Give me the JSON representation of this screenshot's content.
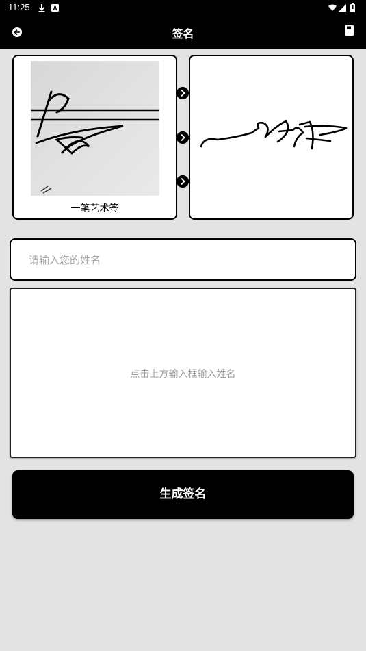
{
  "status_bar": {
    "time": "11:25"
  },
  "app_bar": {
    "title": "签名"
  },
  "style_card": {
    "caption": "一笔艺术签"
  },
  "name_input": {
    "placeholder": "请输入您的姓名",
    "value": ""
  },
  "preview_area": {
    "hint": "点击上方输入框输入姓名"
  },
  "generate_button": {
    "label": "生成签名"
  },
  "colors": {
    "bar": "#000000",
    "background": "#e3e3e3",
    "placeholder": "#a5a5a5"
  }
}
